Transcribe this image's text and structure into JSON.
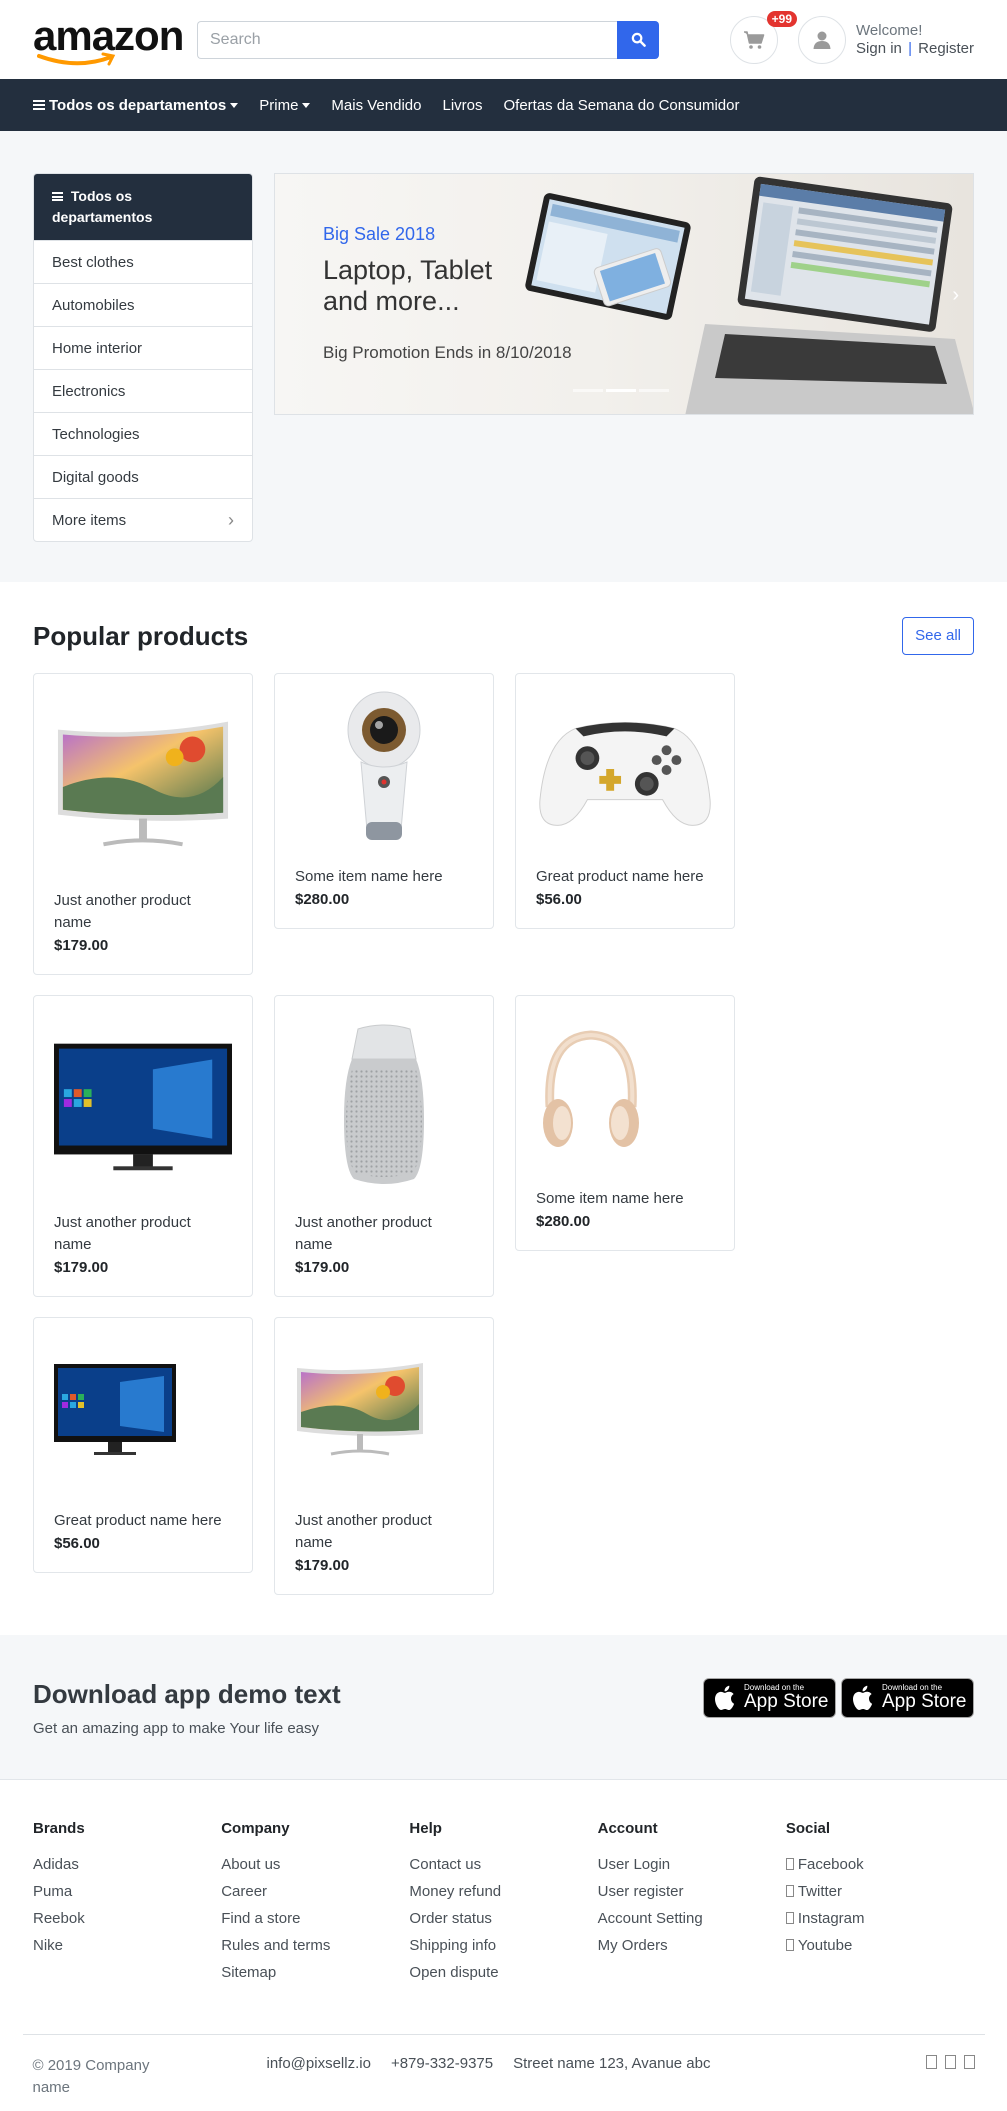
{
  "header": {
    "logo_text": "amazon",
    "search_placeholder": "Search",
    "cart_badge": "+99",
    "welcome": "Welcome!",
    "sign_in": "Sign in",
    "separator": "|",
    "register": "Register",
    "accent_color": "#3167eb"
  },
  "nav": {
    "items": [
      "Todos os departamentos",
      "Prime",
      "Mais Vendido",
      "Livros",
      "Ofertas da Semana do Consumidor"
    ]
  },
  "categories": {
    "title": "Todos os departamentos",
    "items": [
      "Best clothes",
      "Automobiles",
      "Home interior",
      "Electronics",
      "Technologies",
      "Digital goods",
      "More items"
    ]
  },
  "banner": {
    "subtitle": "Big Sale 2018",
    "headline_1": "Laptop, Tablet",
    "headline_2": "and more...",
    "promo": "Big Promotion Ends in 8/10/2018"
  },
  "popular": {
    "title": "Popular products",
    "see_all": "See all",
    "products": [
      {
        "name": "Just another product name",
        "price": "$179.00",
        "image": "curved-monitor"
      },
      {
        "name": "Some item name here",
        "price": "$280.00",
        "image": "360-camera"
      },
      {
        "name": "Great product name here",
        "price": "$56.00",
        "image": "game-controller"
      },
      {
        "name": "Just another product name",
        "price": "$179.00",
        "image": "windows-monitor"
      },
      {
        "name": "Just another product name",
        "price": "$179.00",
        "image": "speaker"
      },
      {
        "name": "Some item name here",
        "price": "$280.00",
        "image": "headphones"
      },
      {
        "name": "Great product name here",
        "price": "$56.00",
        "image": "windows-monitor"
      },
      {
        "name": "Just another product name",
        "price": "$179.00",
        "image": "curved-monitor"
      }
    ]
  },
  "app": {
    "title": "Download app demo text",
    "subtitle": "Get an amazing app to make Your life easy",
    "store_small": "Download on the",
    "store_big": "App Store"
  },
  "footer": {
    "columns": [
      {
        "title": "Brands",
        "links": [
          "Adidas",
          "Puma",
          "Reebok",
          "Nike"
        ]
      },
      {
        "title": "Company",
        "links": [
          "About us",
          "Career",
          "Find a store",
          "Rules and terms",
          "Sitemap"
        ]
      },
      {
        "title": "Help",
        "links": [
          "Contact us",
          "Money refund",
          "Order status",
          "Shipping info",
          "Open dispute"
        ]
      },
      {
        "title": "Account",
        "links": [
          "User Login",
          "User register",
          "Account Setting",
          "My Orders"
        ]
      },
      {
        "title": "Social",
        "links": [
          "Facebook",
          "Twitter",
          "Instagram",
          "Youtube"
        ]
      }
    ],
    "copyright": "© 2019 Company name",
    "email": "info@pixsellz.io",
    "phone": "+879-332-9375",
    "address": "Street name 123, Avanue abc"
  }
}
